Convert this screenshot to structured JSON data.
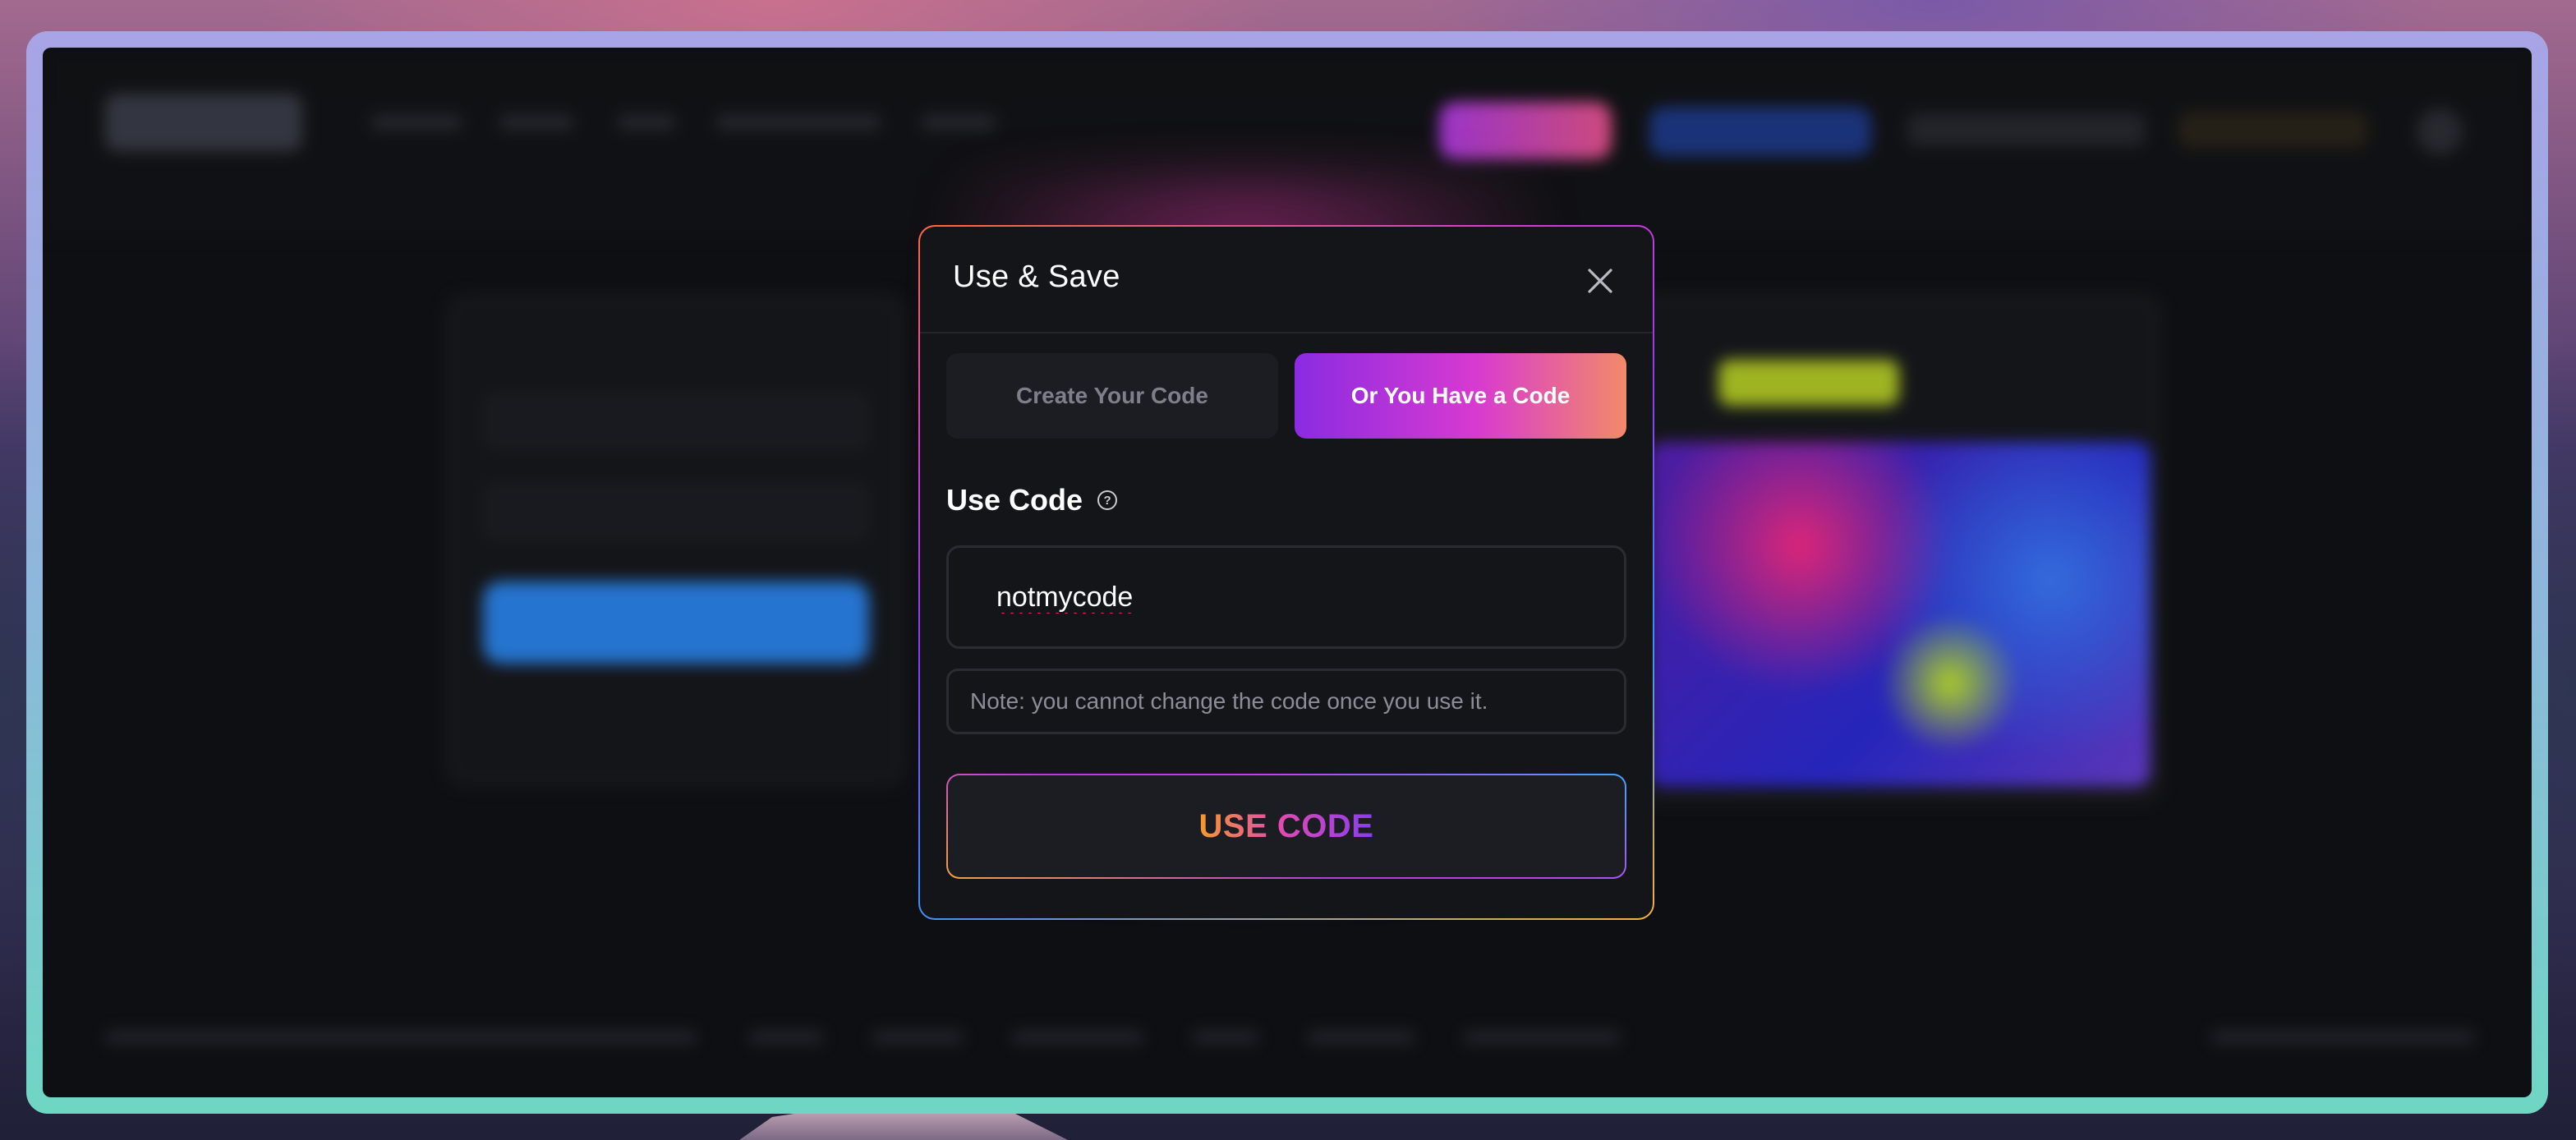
{
  "modal": {
    "title": "Use & Save",
    "tabs": [
      {
        "label": "Create Your Code",
        "active": false
      },
      {
        "label": "Or You Have a Code",
        "active": true
      }
    ],
    "section_label": "Use Code",
    "code_input_value": "notmycode",
    "note": "Note: you cannot change the code once you use it.",
    "submit_label": "USE CODE"
  },
  "icons": {
    "close": "close-icon",
    "help": "help-circle-icon"
  },
  "colors": {
    "modal_bg": "#141519",
    "tab_active_gradient": [
      "#8a2be2",
      "#d83ad0",
      "#f28a6a"
    ],
    "submit_text_gradient": [
      "#f59a2c",
      "#e54ab0",
      "#8a3cf0"
    ],
    "input_spellcheck_underline": "#e0303a"
  }
}
